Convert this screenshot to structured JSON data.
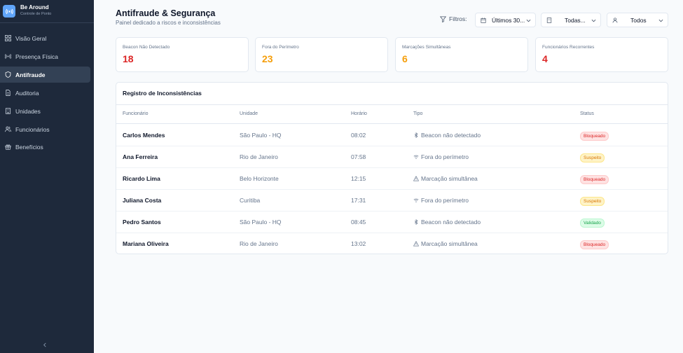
{
  "brand": {
    "name": "Be Around",
    "subtitle": "Controle de Ponto"
  },
  "sidebar": {
    "items": [
      {
        "label": "Visão Geral",
        "icon": "grid-icon",
        "active": false
      },
      {
        "label": "Presença Física",
        "icon": "radio-icon",
        "active": false
      },
      {
        "label": "Antifraude",
        "icon": "shield-icon",
        "active": true
      },
      {
        "label": "Auditoria",
        "icon": "file-icon",
        "active": false
      },
      {
        "label": "Unidades",
        "icon": "building-icon",
        "active": false
      },
      {
        "label": "Funcionários",
        "icon": "users-icon",
        "active": false
      },
      {
        "label": "Benefícios",
        "icon": "gift-icon",
        "active": false
      }
    ],
    "collapse_icon": "chevron-left-icon"
  },
  "header": {
    "title": "Antifraude & Segurança",
    "subtitle": "Painel dedicado a riscos e inconsistências"
  },
  "filters": {
    "label": "Filtros:",
    "period": "Últimos 30...",
    "units": "Todas...",
    "employees": "Todos"
  },
  "stats": [
    {
      "label": "Beacon Não Detectado",
      "value": "18",
      "color": "#dc2626"
    },
    {
      "label": "Fora do Perímetro",
      "value": "23",
      "color": "#f59e0b"
    },
    {
      "label": "Marcações Simultâneas",
      "value": "6",
      "color": "#f59e0b"
    },
    {
      "label": "Funcionários Recorrentes",
      "value": "4",
      "color": "#dc2626"
    }
  ],
  "table": {
    "title": "Registro de Inconsistências",
    "columns": [
      "Funcionário",
      "Unidade",
      "Horário",
      "Tipo",
      "Status"
    ],
    "rows": [
      {
        "name": "Carlos Mendes",
        "unit": "São Paulo - HQ",
        "time": "08:02",
        "type": "Beacon não detectado",
        "type_icon": "bluetooth-icon",
        "status": "Bloqueado",
        "status_kind": "blocked"
      },
      {
        "name": "Ana Ferreira",
        "unit": "Rio de Janeiro",
        "time": "07:58",
        "type": "Fora do perímetro",
        "type_icon": "wifi-icon",
        "status": "Suspeito",
        "status_kind": "suspect"
      },
      {
        "name": "Ricardo Lima",
        "unit": "Belo Horizonte",
        "time": "12:15",
        "type": "Marcação simultânea",
        "type_icon": "alert-triangle-icon",
        "status": "Bloqueado",
        "status_kind": "blocked"
      },
      {
        "name": "Juliana Costa",
        "unit": "Curitiba",
        "time": "17:31",
        "type": "Fora do perímetro",
        "type_icon": "wifi-icon",
        "status": "Suspeito",
        "status_kind": "suspect"
      },
      {
        "name": "Pedro Santos",
        "unit": "São Paulo - HQ",
        "time": "08:45",
        "type": "Beacon não detectado",
        "type_icon": "bluetooth-icon",
        "status": "Validado",
        "status_kind": "validated"
      },
      {
        "name": "Mariana Oliveira",
        "unit": "Rio de Janeiro",
        "time": "13:02",
        "type": "Marcação simultânea",
        "type_icon": "alert-triangle-icon",
        "status": "Bloqueado",
        "status_kind": "blocked"
      }
    ]
  },
  "colors": {
    "sidebar_bg": "#1e293b",
    "accent": "#60a5fa",
    "danger": "#dc2626",
    "warning": "#f59e0b",
    "success": "#16a34a"
  }
}
